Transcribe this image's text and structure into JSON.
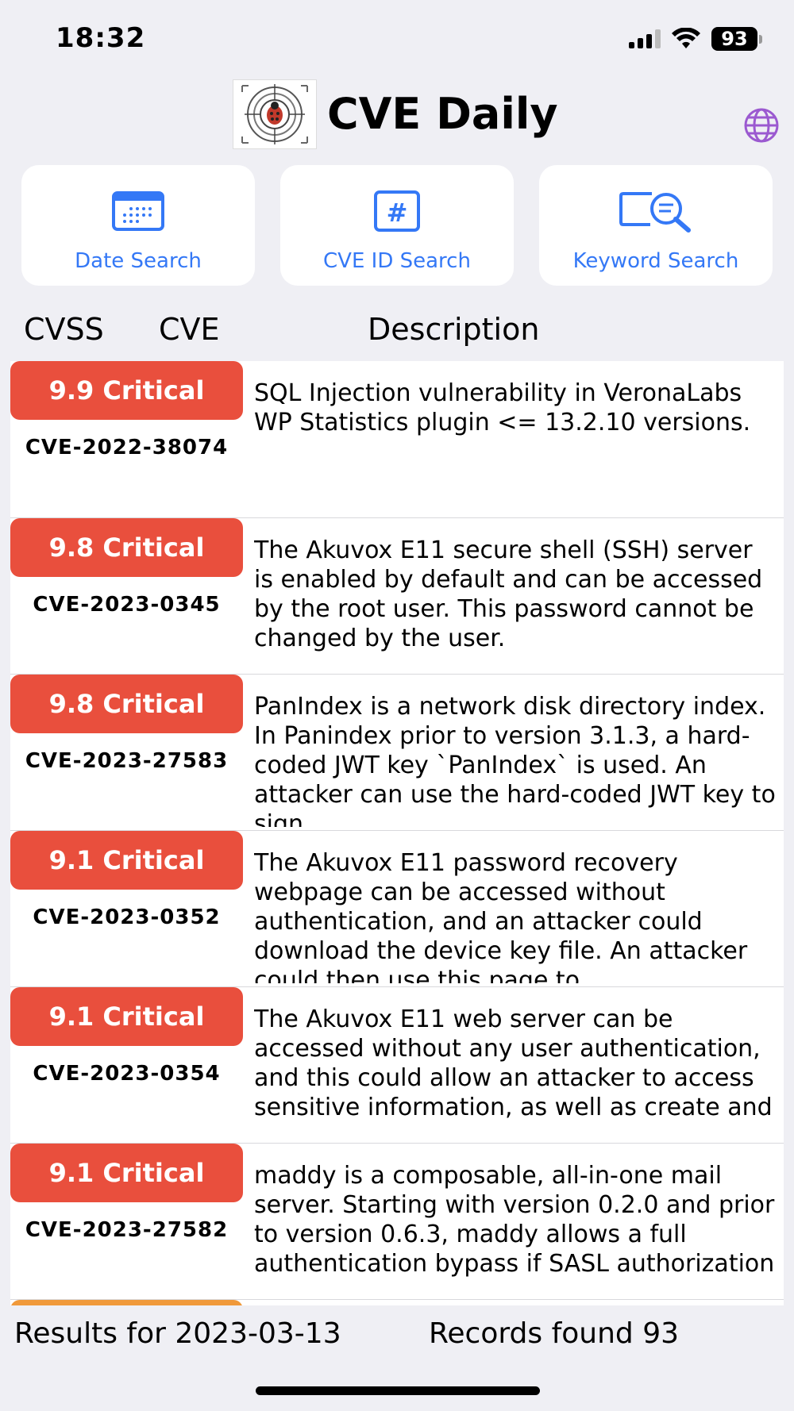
{
  "status": {
    "time": "18:32",
    "battery": "93"
  },
  "header": {
    "title": "CVE Daily"
  },
  "colors": {
    "accent": "#3478f6",
    "critical": "#e94f3d",
    "high": "#f0993a",
    "globe": "#9b59d0"
  },
  "search_buttons": [
    {
      "label": "Date Search",
      "icon": "calendar-icon"
    },
    {
      "label": "CVE ID Search",
      "icon": "hashtag-icon"
    },
    {
      "label": "Keyword Search",
      "icon": "magnifier-icon"
    }
  ],
  "columns": {
    "cvss": "CVSS",
    "cve": "CVE",
    "description": "Description"
  },
  "rows": [
    {
      "score": "9.9 Critical",
      "id": "CVE-2022-38074",
      "description": "SQL Injection vulnerability in VeronaLabs WP Statistics plugin <= 13.2.10 versions."
    },
    {
      "score": "9.8 Critical",
      "id": "CVE-2023-0345",
      "description": "The Akuvox E11 secure shell (SSH) server is enabled by default and can be accessed by the root user. This password cannot be changed by the user."
    },
    {
      "score": "9.8 Critical",
      "id": "CVE-2023-27583",
      "description": "PanIndex is a network disk directory index. In Panindex prior to version 3.1.3, a hard-coded JWT key `PanIndex` is used. An attacker can use the hard-coded JWT key to sign"
    },
    {
      "score": "9.1 Critical",
      "id": "CVE-2023-0352",
      "description": "The Akuvox E11 password recovery webpage can be accessed without authentication, and an attacker could download the device key file. An attacker could then use this page to"
    },
    {
      "score": "9.1 Critical",
      "id": "CVE-2023-0354",
      "description": "The Akuvox E11 web server can be accessed without any user authentication, and this could allow an attacker to access sensitive information, as well as create and"
    },
    {
      "score": "9.1 Critical",
      "id": "CVE-2023-27582",
      "description": "maddy is a composable, all-in-one mail server. Starting with version 0.2.0 and prior to version 0.6.3, maddy allows a full authentication bypass if SASL authorization"
    }
  ],
  "footer": {
    "results": "Results for 2023-03-13",
    "records": "Records found 93"
  }
}
